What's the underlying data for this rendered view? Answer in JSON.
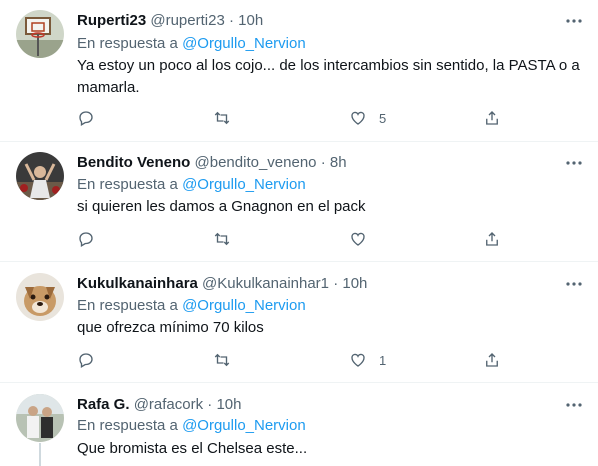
{
  "reply_prefix": "En respuesta a",
  "tweets": [
    {
      "name": "Ruperti23",
      "handle": "@ruperti23",
      "dot": "·",
      "time": "10h",
      "mention": "@Orgullo_Nervion",
      "text": "Ya estoy un poco al los cojo... de los intercambios sin sentido, la PASTA o a mamarla.",
      "likes": "5",
      "avatar_icon": "basketball-hoop-avatar"
    },
    {
      "name": "Bendito Veneno",
      "handle": "@bendito_veneno",
      "dot": "·",
      "time": "8h",
      "mention": "@Orgullo_Nervion",
      "text": "si quieren les damos a Gnagnon en el pack",
      "likes": "",
      "avatar_icon": "celebration-avatar"
    },
    {
      "name": "Kukulkanainhara",
      "handle": "@Kukulkanainhar1",
      "dot": "·",
      "time": "10h",
      "mention": "@Orgullo_Nervion",
      "text": "que ofrezca mínimo 70 kilos",
      "likes": "1",
      "avatar_icon": "dog-avatar"
    },
    {
      "name": "Rafa G.",
      "handle": "@rafacork",
      "dot": "·",
      "time": "10h",
      "mention": "@Orgullo_Nervion",
      "text": "Que bromista es el Chelsea este...",
      "likes": "",
      "avatar_icon": "couple-photo-avatar"
    }
  ],
  "colors": {
    "text": "#0f1419",
    "secondary": "#536471",
    "link": "#1d9bf0",
    "border": "#eff3f4"
  }
}
